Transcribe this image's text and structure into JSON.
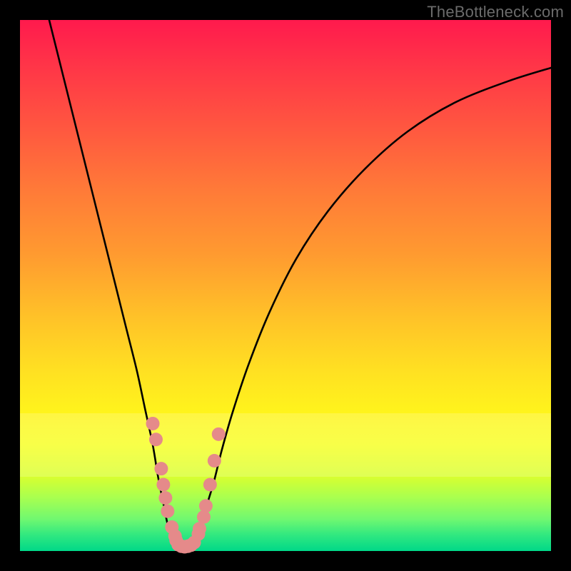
{
  "watermark": "TheBottleneck.com",
  "colors": {
    "curve": "#000000",
    "marker_fill": "#e58a8a",
    "marker_stroke": "#d86e6e"
  },
  "chart_data": {
    "type": "line",
    "title": "",
    "xlabel": "",
    "ylabel": "",
    "xlim": [
      0,
      100
    ],
    "ylim": [
      0,
      100
    ],
    "note": "Axes are unlabeled in the source image; values are normalized 0–100 estimates from pixel positions. y=0 is the bottom (green), y=100 is the top (red).",
    "series": [
      {
        "name": "left-curve",
        "x": [
          5.5,
          8,
          10,
          12,
          14,
          16,
          18,
          20,
          22,
          23.5,
          25,
          26,
          27,
          27.8,
          28.5,
          29,
          29.5
        ],
        "y": [
          100,
          90,
          82,
          74,
          66,
          58,
          50,
          42,
          34,
          27,
          20,
          14,
          9,
          5,
          2.5,
          1,
          0.3
        ]
      },
      {
        "name": "right-curve",
        "x": [
          32.5,
          33,
          34,
          35,
          36.5,
          38,
          40,
          43,
          47,
          52,
          58,
          65,
          73,
          82,
          92,
          100
        ],
        "y": [
          0.3,
          1.5,
          4,
          8,
          13,
          19,
          26,
          35,
          45,
          55,
          64,
          72,
          79,
          84.5,
          88.5,
          91
        ]
      },
      {
        "name": "valley-floor",
        "x": [
          29.5,
          30,
          30.5,
          31,
          31.5,
          32,
          32.5
        ],
        "y": [
          0.3,
          0.15,
          0.1,
          0.1,
          0.1,
          0.15,
          0.3
        ]
      }
    ],
    "markers": {
      "name": "salmon-dots",
      "comment": "Clustered points along the valley walls and floor (visual, approximate).",
      "x": [
        25.0,
        25.6,
        26.6,
        27.0,
        27.4,
        27.8,
        28.6,
        29.4,
        29.2,
        29.8,
        30.4,
        31.0,
        31.6,
        32.2,
        32.8,
        33.6,
        33.8,
        34.6,
        35.0,
        35.8,
        36.6,
        37.4
      ],
      "y": [
        24.0,
        21.0,
        15.5,
        12.5,
        10.0,
        7.5,
        4.5,
        2.0,
        2.8,
        1.2,
        0.9,
        0.8,
        0.9,
        1.1,
        1.6,
        3.2,
        4.2,
        6.4,
        8.5,
        12.5,
        17.0,
        22.0
      ]
    }
  }
}
